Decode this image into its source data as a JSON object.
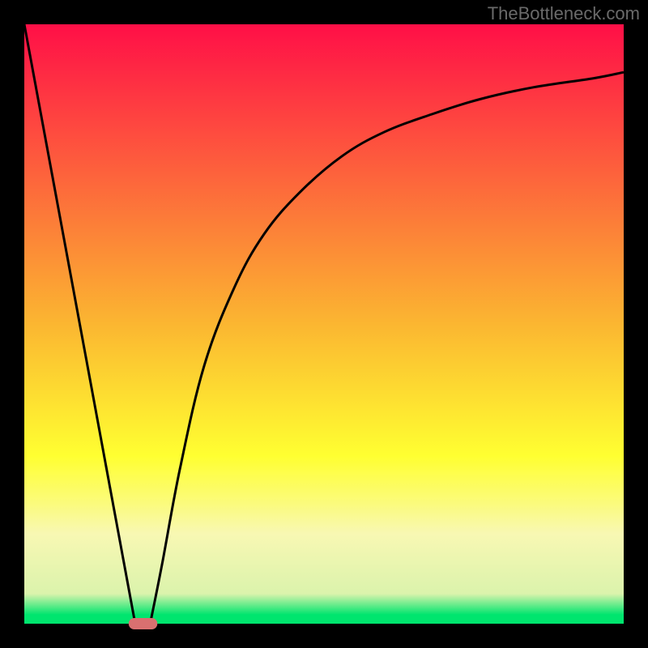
{
  "watermark": "TheBottleneck.com",
  "chart_data": {
    "type": "line",
    "title": "",
    "xlabel": "",
    "ylabel": "",
    "xlim": [
      0,
      100
    ],
    "ylim": [
      0,
      100
    ],
    "series": [
      {
        "name": "left-descent",
        "x": [
          0,
          18.5
        ],
        "values": [
          100,
          0
        ]
      },
      {
        "name": "right-curve",
        "x": [
          21,
          23,
          26,
          30,
          35,
          40,
          46,
          53,
          60,
          68,
          76,
          85,
          95,
          100
        ],
        "values": [
          0,
          10,
          26,
          43,
          56,
          65,
          72,
          78,
          82,
          85,
          87.5,
          89.5,
          91,
          92
        ]
      }
    ],
    "marker": {
      "x_center": 19.8,
      "y": 0,
      "width": 4.8,
      "color": "#d97070"
    },
    "background": {
      "type": "vertical-gradient",
      "stops": [
        {
          "pos": 0.0,
          "color": "#ff0f47"
        },
        {
          "pos": 0.5,
          "color": "#fbb631"
        },
        {
          "pos": 0.72,
          "color": "#ffff31"
        },
        {
          "pos": 0.8,
          "color": "#fbfb7d"
        },
        {
          "pos": 0.85,
          "color": "#f8f8b3"
        },
        {
          "pos": 0.95,
          "color": "#dbf3ac"
        },
        {
          "pos": 0.985,
          "color": "#00e56e"
        },
        {
          "pos": 1.0,
          "color": "#00e56e"
        }
      ]
    },
    "border_px": 30
  }
}
